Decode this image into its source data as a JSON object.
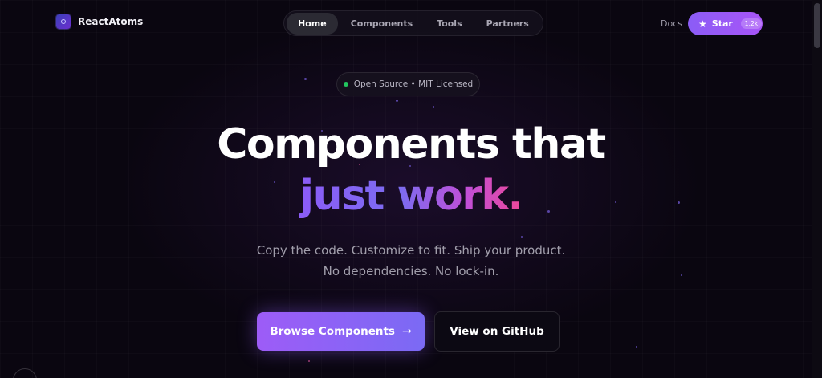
{
  "brand": {
    "name": "ReactAtoms",
    "logo_icon": "atom-logo-icon"
  },
  "nav": {
    "items": [
      {
        "label": "Home",
        "active": true
      },
      {
        "label": "Components",
        "active": false
      },
      {
        "label": "Tools",
        "active": false
      },
      {
        "label": "Partners",
        "active": false
      }
    ]
  },
  "header_actions": {
    "docs_label": "Docs",
    "star_label": "Star",
    "star_count": "1.2k",
    "star_icon": "star-icon"
  },
  "badge": {
    "text": "Open Source • MIT Licensed",
    "status_color": "#22c55e"
  },
  "hero": {
    "headline_line1": "Components that",
    "headline_line2": "just work.",
    "subtitle_line1": "Copy the code. Customize to fit. Ship your product.",
    "subtitle_line2": "No dependencies. No lock-in."
  },
  "cta": {
    "primary_label": "Browse Components",
    "primary_icon": "arrow-right-icon",
    "secondary_label": "View on GitHub"
  },
  "colors": {
    "background": "#0a0610",
    "accent_purple": "#8b5cf6",
    "accent_pink": "#ec4899"
  }
}
